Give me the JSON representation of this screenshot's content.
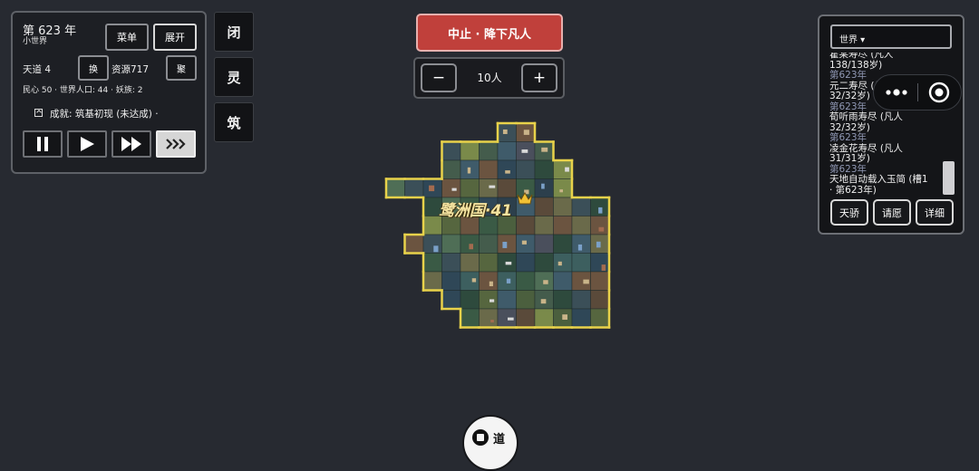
{
  "top_left": {
    "year": "第 623 年",
    "world_name": "小世界",
    "menu_label": "菜单",
    "expand_label": "展开",
    "tiandao": "天道 4",
    "swap_label": "换",
    "resources": "资源717",
    "gather_label": "聚",
    "stats": "民心 50 · 世界人口: 44 · 妖族: 2",
    "achievement_icon": "scroll-icon",
    "achievement": "成就: 筑基初现 (未达成) ·"
  },
  "side_buttons": [
    "闭",
    "灵",
    "筑"
  ],
  "action": {
    "main_label": "中止 · 降下凡人",
    "minus": "−",
    "count": "10人",
    "plus": "+"
  },
  "map": {
    "nation_label": "鹭洲国·41",
    "border_color": "#e8d24a"
  },
  "log_panel": {
    "dropdown": "世界 ▾",
    "lines": [
      {
        "text": "霍某寿尽 (凡人",
        "type": "event"
      },
      {
        "text": "138/138岁)",
        "type": "event"
      },
      {
        "text": "第623年",
        "type": "year"
      },
      {
        "text": "元二寿尽 (凡人",
        "type": "event"
      },
      {
        "text": "32/32岁)",
        "type": "event"
      },
      {
        "text": "第623年",
        "type": "year"
      },
      {
        "text": "荀听雨寿尽 (凡人",
        "type": "event"
      },
      {
        "text": "32/32岁)",
        "type": "event"
      },
      {
        "text": "第623年",
        "type": "year"
      },
      {
        "text": "凌金花寿尽 (凡人",
        "type": "event"
      },
      {
        "text": "31/31岁)",
        "type": "event"
      },
      {
        "text": "第623年",
        "type": "year"
      },
      {
        "text": "天地自动载入玉简 (槽1",
        "type": "event"
      },
      {
        "text": "· 第623年)",
        "type": "event"
      }
    ],
    "buttons": [
      "天骄",
      "请愿",
      "详细"
    ]
  },
  "capsule": {
    "more_icon": "more-dots-icon",
    "close_icon": "target-circle-icon"
  },
  "bottom": {
    "label": "道"
  },
  "speed_controls": {
    "icons": [
      "pause-icon",
      "play-icon",
      "fast-forward-icon",
      "triple-forward-icon"
    ],
    "active": 3
  }
}
